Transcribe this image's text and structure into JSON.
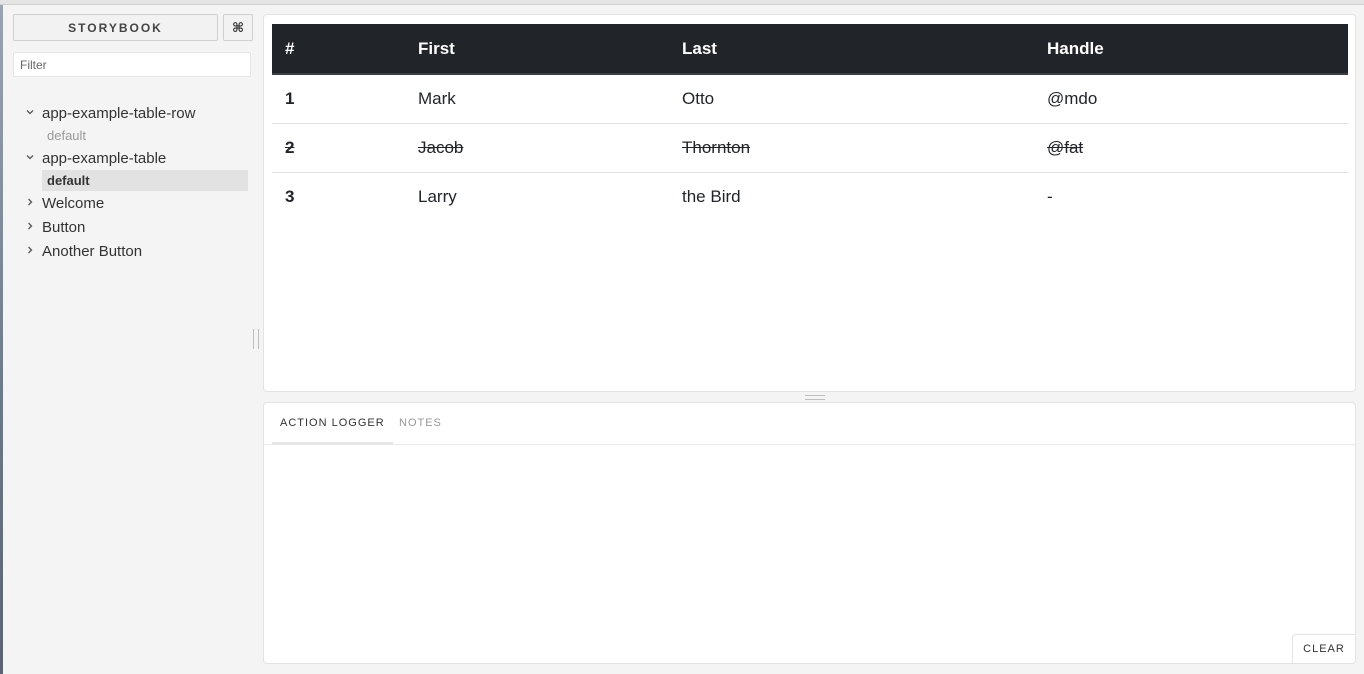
{
  "sidebar": {
    "brand": "STORYBOOK",
    "shortcut_icon": "⌘",
    "filter_placeholder": "Filter",
    "tree": {
      "table_row_kind": "app-example-table-row",
      "table_row_story": "default",
      "table_kind": "app-example-table",
      "table_story": "default",
      "welcome": "Welcome",
      "button": "Button",
      "another_button": "Another Button"
    },
    "icons": {
      "expanded": "chevron-down-icon",
      "collapsed": "chevron-right-icon"
    }
  },
  "preview": {
    "columns": [
      "#",
      "First",
      "Last",
      "Handle"
    ],
    "rows": [
      {
        "num": "1",
        "first": "Mark",
        "last": "Otto",
        "handle": "@mdo",
        "strikethrough": false
      },
      {
        "num": "2",
        "first": "Jacob",
        "last": "Thornton",
        "handle": "@fat",
        "strikethrough": true
      },
      {
        "num": "3",
        "first": "Larry",
        "last": "the Bird",
        "handle": "-",
        "strikethrough": false
      }
    ],
    "header_bg": "#212529"
  },
  "addons": {
    "tabs": [
      "ACTION LOGGER",
      "NOTES"
    ],
    "active_tab": "ACTION LOGGER",
    "clear_label": "CLEAR"
  }
}
